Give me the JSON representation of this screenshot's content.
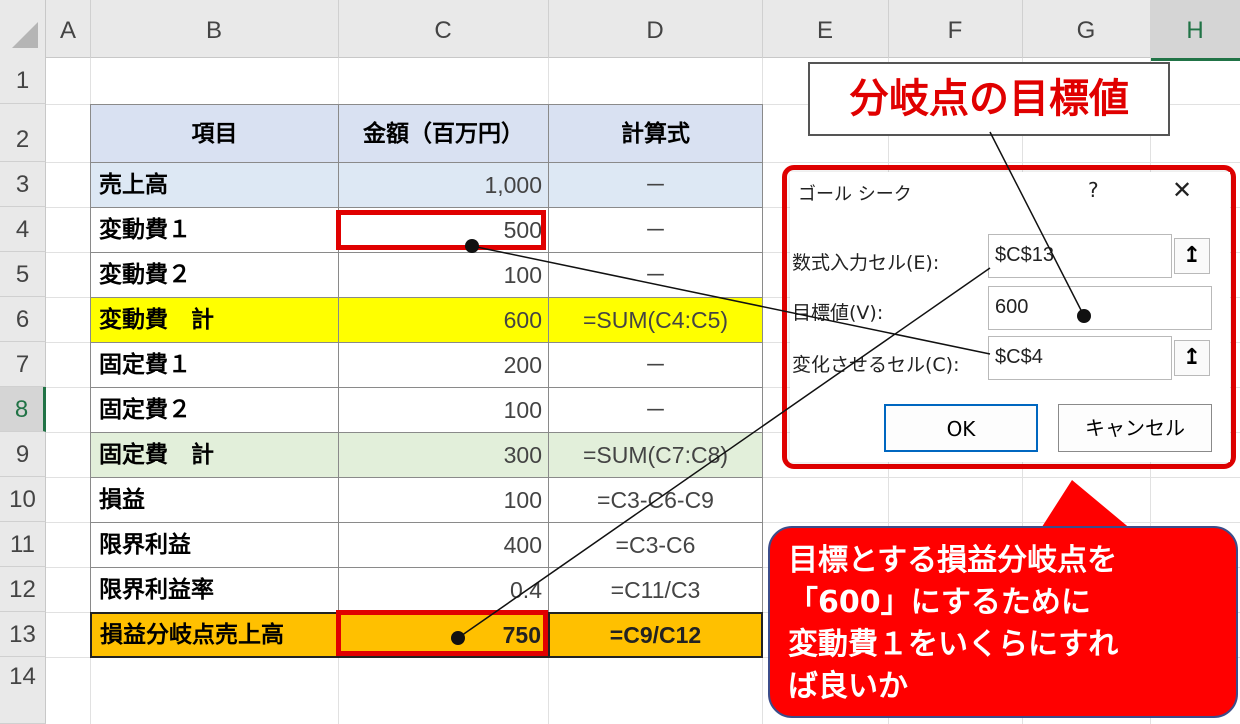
{
  "columns": [
    "A",
    "B",
    "C",
    "D",
    "E",
    "F",
    "G",
    "H"
  ],
  "rows": [
    "1",
    "2",
    "3",
    "4",
    "5",
    "6",
    "7",
    "8",
    "9",
    "10",
    "11",
    "12",
    "13",
    "14"
  ],
  "table": {
    "headers": [
      "項目",
      "金額（百万円）",
      "計算式"
    ],
    "rows": [
      {
        "item": "売上高",
        "value": "1,000",
        "formula": "－"
      },
      {
        "item": "変動費１",
        "value": "500",
        "formula": "－"
      },
      {
        "item": "変動費２",
        "value": "100",
        "formula": "－"
      },
      {
        "item": "変動費　計",
        "value": "600",
        "formula": "=SUM(C4:C5)"
      },
      {
        "item": "固定費１",
        "value": "200",
        "formula": "－"
      },
      {
        "item": "固定費２",
        "value": "100",
        "formula": "－"
      },
      {
        "item": "固定費　計",
        "value": "300",
        "formula": "=SUM(C7:C8)"
      },
      {
        "item": "損益",
        "value": "100",
        "formula": "=C3-C6-C9"
      },
      {
        "item": "限界利益",
        "value": "400",
        "formula": "=C3-C6"
      },
      {
        "item": "限界利益率",
        "value": "0.4",
        "formula": "=C11/C3"
      },
      {
        "item": "損益分岐点売上高",
        "value": "750",
        "formula": "=C9/C12"
      }
    ]
  },
  "callout_title": "分岐点の目標値",
  "dialog": {
    "title": "ゴール シーク",
    "help": "?",
    "close": "✕",
    "set_cell_label": "数式入力セル(E):",
    "set_cell_value": "$C$13",
    "to_value_label": "目標値(V):",
    "to_value_value": "600",
    "changing_cell_label": "変化させるセル(C):",
    "changing_cell_value": "$C$4",
    "ref_icon": "↥",
    "ok": "OK",
    "cancel": "キャンセル"
  },
  "speech": "目標とする損益分岐点を\n「600」にするために\n変動費１をいくらにすれ\nば良いか",
  "colors": {
    "header_blue": "#d9e1f2",
    "sales_blue": "#dde8f4",
    "yellow": "#ffff00",
    "green": "#e2efda",
    "orange": "#ffc000",
    "red": "#e00000"
  }
}
